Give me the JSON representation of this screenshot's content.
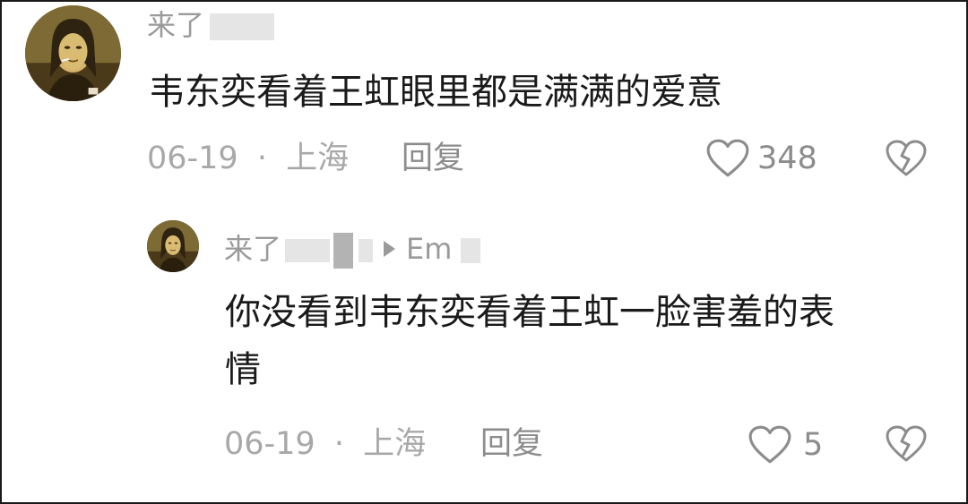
{
  "comment": {
    "username_visible": "来了",
    "text": "韦东奕看着王虹眼里都是满满的爱意",
    "date": "06-19",
    "separator": "·",
    "location": "上海",
    "reply_label": "回复",
    "like_count": "348"
  },
  "reply": {
    "username_visible": "来了",
    "reply_to_visible": "Em",
    "text_line1": "你没看到韦东奕看着王虹一脸害羞的表",
    "text_line2": "情",
    "date": "06-19",
    "separator": "·",
    "location": "上海",
    "reply_label": "回复",
    "like_count": "5"
  },
  "colors": {
    "text": "#1a1a1a",
    "muted": "#9a9a9a",
    "icon": "#8c8c8c"
  },
  "icons": {
    "like": "heart-outline-icon",
    "dislike": "broken-heart-icon"
  }
}
